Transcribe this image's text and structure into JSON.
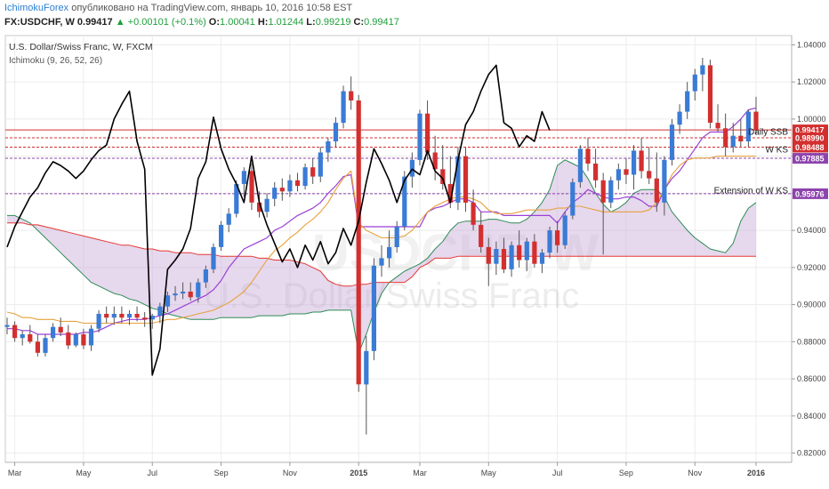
{
  "header": {
    "publisher": "IchimokuForex",
    "published_text": " опубликовано на TradingView.com, январь 10, 2016 10:58 EST",
    "symbol": "FX:USDCHF, W",
    "last": "0.99417",
    "change": "▲ +0.00101 (+0.1%)",
    "o_label": "O:",
    "o": "1.00041",
    "h_label": "H:",
    "h": "1.01244",
    "l_label": "L:",
    "l": "0.99219",
    "c_label": "C:",
    "c": "0.99417"
  },
  "chart_data": {
    "type": "candlestick",
    "title": "U.S. Dollar/Swiss Franc, W, FXCM",
    "indicator": "Ichimoku (9, 26, 52, 26)",
    "watermark_symbol": "USDCHF, W",
    "watermark_name": "U.S. Dollar/Swiss Franc",
    "ylim": [
      0.815,
      1.045
    ],
    "yticks": [
      "0.82000",
      "0.84000",
      "0.86000",
      "0.88000",
      "0.90000",
      "0.92000",
      "0.94000",
      "0.96000",
      "0.98000",
      "1.00000",
      "1.02000",
      "1.04000"
    ],
    "xticks": [
      {
        "label": "Mar",
        "bar": 1
      },
      {
        "label": "May",
        "bar": 10
      },
      {
        "label": "Jul",
        "bar": 19
      },
      {
        "label": "Sep",
        "bar": 28
      },
      {
        "label": "Nov",
        "bar": 37
      },
      {
        "label": "2015",
        "bar": 46
      },
      {
        "label": "Mar",
        "bar": 54
      },
      {
        "label": "May",
        "bar": 63
      },
      {
        "label": "Jul",
        "bar": 72
      },
      {
        "label": "Sep",
        "bar": 81
      },
      {
        "label": "Nov",
        "bar": 90
      },
      {
        "label": "2016",
        "bar": 98
      }
    ],
    "candles": [
      [
        0.888,
        0.893,
        0.884,
        0.889
      ],
      [
        0.889,
        0.891,
        0.88,
        0.882
      ],
      [
        0.882,
        0.886,
        0.878,
        0.884
      ],
      [
        0.884,
        0.889,
        0.879,
        0.88
      ],
      [
        0.88,
        0.884,
        0.872,
        0.874
      ],
      [
        0.874,
        0.884,
        0.872,
        0.882
      ],
      [
        0.882,
        0.89,
        0.88,
        0.888
      ],
      [
        0.888,
        0.893,
        0.883,
        0.885
      ],
      [
        0.885,
        0.889,
        0.876,
        0.878
      ],
      [
        0.878,
        0.885,
        0.877,
        0.884
      ],
      [
        0.884,
        0.887,
        0.876,
        0.878
      ],
      [
        0.878,
        0.889,
        0.875,
        0.887
      ],
      [
        0.887,
        0.897,
        0.885,
        0.895
      ],
      [
        0.895,
        0.899,
        0.89,
        0.893
      ],
      [
        0.893,
        0.899,
        0.889,
        0.895
      ],
      [
        0.895,
        0.899,
        0.89,
        0.893
      ],
      [
        0.893,
        0.897,
        0.889,
        0.895
      ],
      [
        0.895,
        0.899,
        0.891,
        0.893
      ],
      [
        0.893,
        0.896,
        0.888,
        0.892
      ],
      [
        0.892,
        0.895,
        0.887,
        0.894
      ],
      [
        0.894,
        0.901,
        0.89,
        0.899
      ],
      [
        0.899,
        0.907,
        0.896,
        0.905
      ],
      [
        0.905,
        0.91,
        0.902,
        0.906
      ],
      [
        0.906,
        0.912,
        0.903,
        0.907
      ],
      [
        0.907,
        0.912,
        0.902,
        0.904
      ],
      [
        0.904,
        0.914,
        0.901,
        0.912
      ],
      [
        0.912,
        0.921,
        0.909,
        0.919
      ],
      [
        0.919,
        0.933,
        0.917,
        0.931
      ],
      [
        0.931,
        0.945,
        0.929,
        0.943
      ],
      [
        0.943,
        0.952,
        0.939,
        0.949
      ],
      [
        0.949,
        0.967,
        0.947,
        0.965
      ],
      [
        0.965,
        0.974,
        0.958,
        0.972
      ],
      [
        0.972,
        0.976,
        0.951,
        0.955
      ],
      [
        0.955,
        0.961,
        0.947,
        0.95
      ],
      [
        0.95,
        0.96,
        0.947,
        0.957
      ],
      [
        0.957,
        0.966,
        0.953,
        0.963
      ],
      [
        0.963,
        0.968,
        0.956,
        0.961
      ],
      [
        0.961,
        0.97,
        0.958,
        0.967
      ],
      [
        0.967,
        0.971,
        0.961,
        0.964
      ],
      [
        0.964,
        0.976,
        0.962,
        0.974
      ],
      [
        0.974,
        0.979,
        0.965,
        0.969
      ],
      [
        0.969,
        0.985,
        0.966,
        0.982
      ],
      [
        0.982,
        0.99,
        0.977,
        0.988
      ],
      [
        0.988,
        1.001,
        0.985,
        0.998
      ],
      [
        0.998,
        1.018,
        0.995,
        1.015
      ],
      [
        1.015,
        1.023,
        1.005,
        1.01
      ],
      [
        1.01,
        1.013,
        0.853,
        0.857
      ],
      [
        0.857,
        0.883,
        0.83,
        0.875
      ],
      [
        0.875,
        0.925,
        0.87,
        0.921
      ],
      [
        0.921,
        0.932,
        0.915,
        0.925
      ],
      [
        0.925,
        0.94,
        0.92,
        0.931
      ],
      [
        0.931,
        0.945,
        0.928,
        0.942
      ],
      [
        0.942,
        0.972,
        0.94,
        0.969
      ],
      [
        0.969,
        0.982,
        0.963,
        0.978
      ],
      [
        0.978,
        1.005,
        0.975,
        1.003
      ],
      [
        1.003,
        1.01,
        0.978,
        0.982
      ],
      [
        0.982,
        0.991,
        0.967,
        0.973
      ],
      [
        0.973,
        0.986,
        0.962,
        0.965
      ],
      [
        0.965,
        0.98,
        0.952,
        0.955
      ],
      [
        0.955,
        0.985,
        0.951,
        0.98
      ],
      [
        0.98,
        0.985,
        0.95,
        0.955
      ],
      [
        0.955,
        0.962,
        0.94,
        0.943
      ],
      [
        0.943,
        0.95,
        0.928,
        0.931
      ],
      [
        0.931,
        0.936,
        0.91,
        0.922
      ],
      [
        0.922,
        0.934,
        0.916,
        0.93
      ],
      [
        0.93,
        0.936,
        0.917,
        0.919
      ],
      [
        0.919,
        0.934,
        0.915,
        0.932
      ],
      [
        0.932,
        0.94,
        0.92,
        0.924
      ],
      [
        0.924,
        0.936,
        0.918,
        0.934
      ],
      [
        0.934,
        0.938,
        0.92,
        0.922
      ],
      [
        0.922,
        0.93,
        0.917,
        0.928
      ],
      [
        0.928,
        0.942,
        0.925,
        0.94
      ],
      [
        0.94,
        0.945,
        0.928,
        0.932
      ],
      [
        0.932,
        0.95,
        0.93,
        0.948
      ],
      [
        0.948,
        0.968,
        0.946,
        0.966
      ],
      [
        0.966,
        0.986,
        0.963,
        0.984
      ],
      [
        0.984,
        0.99,
        0.972,
        0.976
      ],
      [
        0.976,
        0.984,
        0.963,
        0.967
      ],
      [
        0.967,
        0.971,
        0.927,
        0.955
      ],
      [
        0.955,
        0.969,
        0.952,
        0.967
      ],
      [
        0.967,
        0.976,
        0.962,
        0.973
      ],
      [
        0.973,
        0.979,
        0.965,
        0.97
      ],
      [
        0.97,
        0.986,
        0.962,
        0.983
      ],
      [
        0.983,
        0.99,
        0.968,
        0.972
      ],
      [
        0.972,
        0.985,
        0.965,
        0.968
      ],
      [
        0.968,
        0.982,
        0.95,
        0.955
      ],
      [
        0.955,
        0.98,
        0.948,
        0.978
      ],
      [
        0.978,
        1.0,
        0.975,
        0.997
      ],
      [
        0.997,
        1.008,
        0.992,
        1.004
      ],
      [
        1.004,
        1.02,
        1.0,
        1.015
      ],
      [
        1.015,
        1.027,
        1.01,
        1.024
      ],
      [
        1.024,
        1.033,
        1.015,
        1.029
      ],
      [
        1.029,
        1.032,
        0.995,
        0.998
      ],
      [
        0.998,
        1.008,
        0.993,
        0.995
      ],
      [
        0.995,
        1.003,
        0.98,
        0.985
      ],
      [
        0.985,
        0.998,
        0.982,
        0.991
      ],
      [
        0.991,
        1.0,
        0.985,
        0.988
      ],
      [
        0.988,
        1.005,
        0.985,
        1.004
      ],
      [
        1.004,
        1.012,
        0.992,
        0.994
      ]
    ],
    "kijun": [
      0.887,
      0.887,
      0.886,
      0.886,
      0.884,
      0.884,
      0.884,
      0.884,
      0.884,
      0.884,
      0.885,
      0.885,
      0.886,
      0.888,
      0.89,
      0.891,
      0.892,
      0.892,
      0.892,
      0.893,
      0.894,
      0.895,
      0.897,
      0.899,
      0.901,
      0.903,
      0.905,
      0.908,
      0.913,
      0.92,
      0.925,
      0.93,
      0.932,
      0.934,
      0.936,
      0.94,
      0.942,
      0.945,
      0.948,
      0.95,
      0.952,
      0.955,
      0.96,
      0.964,
      0.969,
      0.97,
      0.942,
      0.942,
      0.942,
      0.942,
      0.942,
      0.942,
      0.942,
      0.942,
      0.942,
      0.95,
      0.952,
      0.953,
      0.955,
      0.957,
      0.957,
      0.955,
      0.95,
      0.95,
      0.95,
      0.948,
      0.948,
      0.948,
      0.948,
      0.948,
      0.948,
      0.948,
      0.944,
      0.95,
      0.955,
      0.958,
      0.962,
      0.96,
      0.958,
      0.957,
      0.957,
      0.958,
      0.958,
      0.956,
      0.953,
      0.953,
      0.962,
      0.968,
      0.972,
      0.978,
      0.984,
      0.99,
      0.993,
      0.993,
      0.993,
      0.996,
      1.0,
      1.005,
      1.006
    ],
    "tenkan": [
      0.896,
      0.895,
      0.893,
      0.893,
      0.892,
      0.892,
      0.892,
      0.891,
      0.891,
      0.891,
      0.89,
      0.89,
      0.89,
      0.89,
      0.89,
      0.89,
      0.89,
      0.89,
      0.89,
      0.89,
      0.891,
      0.892,
      0.892,
      0.893,
      0.894,
      0.895,
      0.896,
      0.897,
      0.899,
      0.901,
      0.904,
      0.907,
      0.912,
      0.918,
      0.924,
      0.929,
      0.932,
      0.936,
      0.939,
      0.943,
      0.946,
      0.95,
      0.955,
      0.962,
      0.968,
      0.972,
      0.944,
      0.94,
      0.938,
      0.936,
      0.936,
      0.936,
      0.937,
      0.94,
      0.945,
      0.95,
      0.953,
      0.955,
      0.957,
      0.958,
      0.958,
      0.957,
      0.955,
      0.951,
      0.949,
      0.949,
      0.949,
      0.95,
      0.951,
      0.951,
      0.951,
      0.951,
      0.952,
      0.952,
      0.953,
      0.953,
      0.952,
      0.951,
      0.95,
      0.95,
      0.95,
      0.95,
      0.95,
      0.95,
      0.951,
      0.955,
      0.962,
      0.97,
      0.975,
      0.978,
      0.979,
      0.979,
      0.979,
      0.98,
      0.98,
      0.98,
      0.98,
      0.98,
      0.98
    ],
    "chikou_end_bar": 72,
    "chikou": [
      0.931,
      0.942,
      0.95,
      0.958,
      0.963,
      0.971,
      0.977,
      0.975,
      0.972,
      0.968,
      0.972,
      0.978,
      0.983,
      0.986,
      1.0,
      1.008,
      1.015,
      0.988,
      0.973,
      0.862,
      0.876,
      0.919,
      0.924,
      0.93,
      0.941,
      0.968,
      0.977,
      1.001,
      0.984,
      0.973,
      0.965,
      0.955,
      0.98,
      0.955,
      0.943,
      0.933,
      0.923,
      0.93,
      0.92,
      0.932,
      0.924,
      0.934,
      0.922,
      0.928,
      0.941,
      0.932,
      0.945,
      0.966,
      0.984,
      0.976,
      0.967,
      0.955,
      0.967,
      0.973,
      0.97,
      0.983,
      0.972,
      0.968,
      0.955,
      0.978,
      0.997,
      1.004,
      1.015,
      1.024,
      1.029,
      0.998,
      0.995,
      0.985,
      0.991,
      0.988,
      1.004,
      0.994
    ],
    "span_a": [
      0.948,
      0.948,
      0.946,
      0.944,
      0.94,
      0.936,
      0.932,
      0.928,
      0.924,
      0.92,
      0.916,
      0.912,
      0.91,
      0.908,
      0.906,
      0.905,
      0.903,
      0.902,
      0.9,
      0.898,
      0.897,
      0.895,
      0.894,
      0.893,
      0.892,
      0.892,
      0.892,
      0.892,
      0.893,
      0.893,
      0.893,
      0.893,
      0.893,
      0.894,
      0.894,
      0.894,
      0.894,
      0.895,
      0.895,
      0.895,
      0.896,
      0.896,
      0.897,
      0.897,
      0.897,
      0.897,
      0.874,
      0.884,
      0.896,
      0.906,
      0.912,
      0.915,
      0.918,
      0.92,
      0.922,
      0.925,
      0.93,
      0.934,
      0.94,
      0.944,
      0.945,
      0.945,
      0.945,
      0.946,
      0.946,
      0.945,
      0.944,
      0.944,
      0.946,
      0.95,
      0.955,
      0.962,
      0.975,
      0.978,
      0.976,
      0.974,
      0.968,
      0.96,
      0.954,
      0.95,
      0.952,
      0.955,
      0.96,
      0.962,
      0.962,
      0.962,
      0.958,
      0.95,
      0.945,
      0.94,
      0.936,
      0.933,
      0.93,
      0.929,
      0.928,
      0.933,
      0.945,
      0.952,
      0.955
    ],
    "span_b": [
      0.944,
      0.944,
      0.944,
      0.943,
      0.943,
      0.942,
      0.941,
      0.94,
      0.939,
      0.938,
      0.937,
      0.936,
      0.935,
      0.934,
      0.933,
      0.932,
      0.932,
      0.931,
      0.93,
      0.93,
      0.929,
      0.929,
      0.928,
      0.928,
      0.928,
      0.927,
      0.927,
      0.927,
      0.926,
      0.926,
      0.926,
      0.926,
      0.926,
      0.925,
      0.925,
      0.924,
      0.924,
      0.924,
      0.923,
      0.922,
      0.92,
      0.918,
      0.913,
      0.911,
      0.91,
      0.91,
      0.911,
      0.911,
      0.912,
      0.912,
      0.912,
      0.912,
      0.912,
      0.915,
      0.92,
      0.922,
      0.925,
      0.925,
      0.925,
      0.926,
      0.926,
      0.926,
      0.926,
      0.926,
      0.926,
      0.926,
      0.926,
      0.926,
      0.926,
      0.926,
      0.926,
      0.926,
      0.926,
      0.926,
      0.926,
      0.926,
      0.926,
      0.926,
      0.926,
      0.926,
      0.926,
      0.926,
      0.926,
      0.926,
      0.926,
      0.926,
      0.926,
      0.926,
      0.926,
      0.926,
      0.926,
      0.926,
      0.926,
      0.926,
      0.926,
      0.926,
      0.926,
      0.926,
      0.926
    ],
    "hlines": [
      {
        "value": 0.99417,
        "color": "#d32f2f",
        "label": "0.99417",
        "dash": false
      },
      {
        "value": 0.9899,
        "color": "#d32f2f",
        "label": "0.98990",
        "dash": true
      },
      {
        "value": 0.98488,
        "color": "#d32f2f",
        "label": "0.98488",
        "dash": true
      },
      {
        "value": 0.97885,
        "color": "#8e44ad",
        "label": "0.97885",
        "dash": true
      },
      {
        "value": 0.95976,
        "color": "#8e44ad",
        "label": "0.95976",
        "dash": true
      }
    ],
    "annotations": [
      {
        "text": "Daily SSB",
        "value": 0.9935
      },
      {
        "text": "W KS",
        "value": 0.9839
      },
      {
        "text": "Extension of W KS",
        "value": 0.9619
      }
    ],
    "colors": {
      "up": "#3a7bd5",
      "down": "#d32f2f",
      "tenkan": "#e6a23c",
      "kijun": "#9b3fd6",
      "chikou": "#000000",
      "span_a": "#2e8b57",
      "span_b": "#e53935",
      "cloud": "#c8a9d8"
    }
  }
}
